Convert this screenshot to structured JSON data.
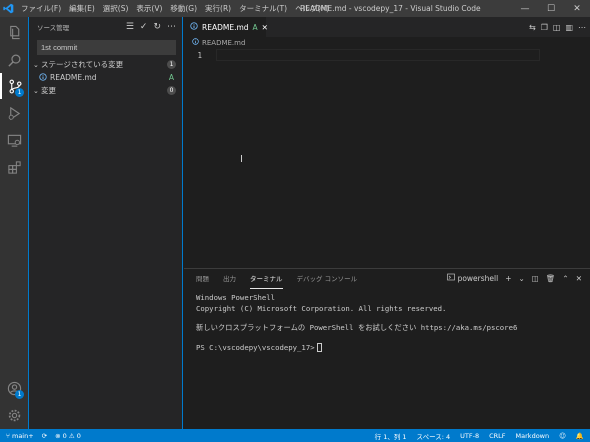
{
  "titlebar": {
    "menu": [
      "ファイル(F)",
      "編集(E)",
      "選択(S)",
      "表示(V)",
      "移動(G)",
      "実行(R)",
      "ターミナル(T)",
      "ヘルプ(H)"
    ],
    "title": "README.md - vscodepy_17 - Visual Studio Code",
    "minimize": "—",
    "maximize": "☐",
    "close": "✕"
  },
  "activitybar": {
    "scm_badge": "1",
    "accounts_badge": "1"
  },
  "sidebar": {
    "header": "ソース管理",
    "commit_message": "1st commit",
    "staged": {
      "label": "ステージされている変更",
      "count": "1"
    },
    "staged_files": [
      {
        "name": "README.md",
        "status": "A"
      }
    ],
    "changes": {
      "label": "変更",
      "count": "0"
    }
  },
  "editor": {
    "tab_label": "README.md",
    "tab_status": "A",
    "breadcrumb": "README.md",
    "line_number": "1"
  },
  "panel": {
    "tabs": [
      "問題",
      "出力",
      "ターミナル",
      "デバッグ コンソール"
    ],
    "active_tab": "ターミナル",
    "terminal_name": "powershell",
    "lines": [
      "Windows PowerShell",
      "Copyright (C) Microsoft Corporation. All rights reserved.",
      "",
      "新しいクロスプラットフォームの PowerShell をお試しください https://aka.ms/pscore6",
      "",
      "PS C:\\vscodepy\\vscodepy_17>"
    ]
  },
  "statusbar": {
    "branch": "main+",
    "errors": "0",
    "warnings": "0",
    "position": "行 1、列 1",
    "spaces": "スペース: 4",
    "encoding": "UTF-8",
    "eol": "CRLF",
    "language": "Markdown"
  },
  "colors": {
    "accent": "#007acc",
    "added": "#73c991"
  }
}
